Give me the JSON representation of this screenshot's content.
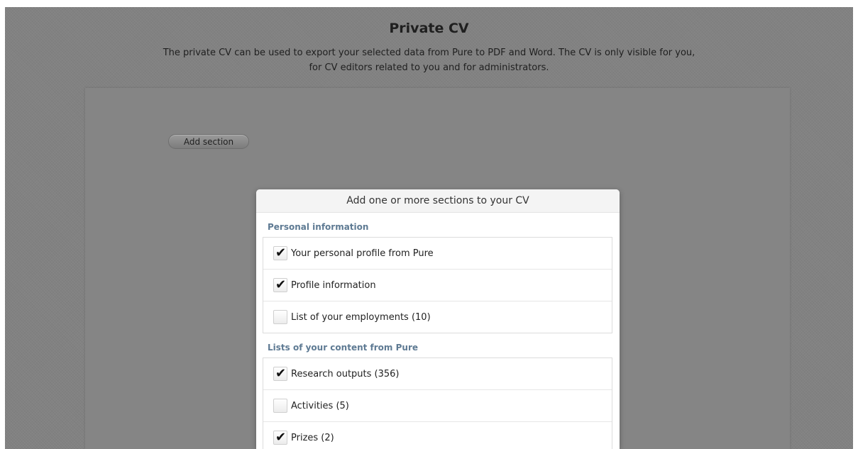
{
  "header": {
    "title": "Private CV",
    "description": "The private CV can be used to export your selected data from Pure to PDF and Word. The CV is only visible for you, for CV editors related to you and for administrators."
  },
  "toolbar": {
    "add_section_label": "Add section"
  },
  "dialog": {
    "title": "Add one or more sections to your CV",
    "groups": [
      {
        "title": "Personal information",
        "items": [
          {
            "label": "Your personal profile from Pure",
            "checked": true
          },
          {
            "label": "Profile information",
            "checked": true
          },
          {
            "label": "List of your employments (10)",
            "checked": false
          }
        ]
      },
      {
        "title": "Lists of your content from Pure",
        "items": [
          {
            "label": "Research outputs (356)",
            "checked": true
          },
          {
            "label": "Activities (5)",
            "checked": false
          },
          {
            "label": "Prizes (2)",
            "checked": true
          }
        ]
      }
    ]
  }
}
